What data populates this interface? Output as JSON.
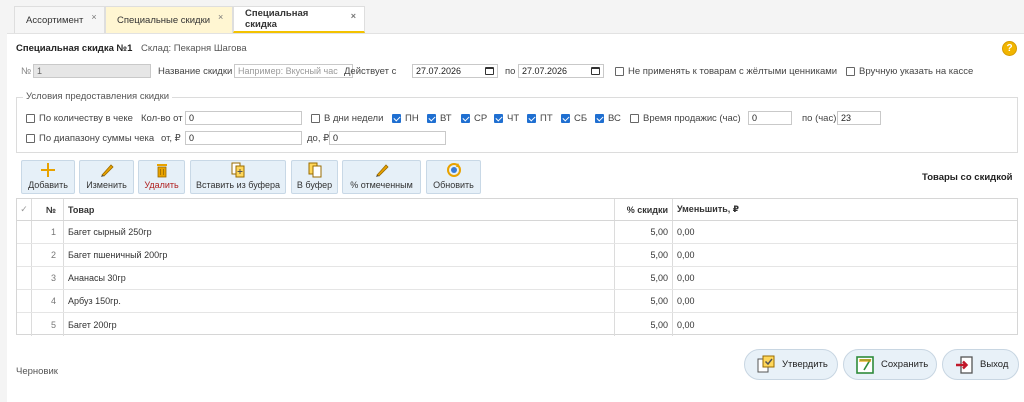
{
  "tabs": [
    {
      "label": "Ассортимент",
      "close": "×"
    },
    {
      "label": "Специальные скидки",
      "close": "×"
    },
    {
      "label": "Специальная скидка",
      "close": "×"
    }
  ],
  "header": {
    "title": "Специальная скидка №1",
    "warehouse": "Склад: Пекарня Шагова",
    "help": "?"
  },
  "form": {
    "number_label": "№",
    "number_value": "1",
    "name_label": "Название скидки",
    "name_placeholder": "Например: Вкусный час",
    "from_label": "Действует с",
    "from_value": "27.07.2026",
    "to_label": "по",
    "to_value": "27.07.2026",
    "no_yellow_label": "Не применять к товарам с жёлтыми ценниками",
    "manual_label": "Вручную указать на кассе"
  },
  "conditions": {
    "title": "Условия предоставления скидки",
    "by_qty_label": "По количеству в чеке",
    "qty_from_label": "Кол-во от",
    "qty_from_value": "0",
    "weekdays_label": "В дни недели",
    "days": [
      "ПН",
      "ВТ",
      "СР",
      "ЧТ",
      "ПТ",
      "СБ",
      "ВС"
    ],
    "time_label": "Время продажи",
    "time_from_label": "с (час)",
    "time_from_value": "0",
    "time_to_label": "по (час)",
    "time_to_value": "23",
    "by_sum_label": "По диапазону суммы чека",
    "sum_from_label": "от, ₽",
    "sum_from_value": "0",
    "sum_to_label": "до, ₽",
    "sum_to_value": "0"
  },
  "toolbar": {
    "add": "Добавить",
    "edit": "Изменить",
    "delete": "Удалить",
    "paste": "Вставить из буфера",
    "copy": "В буфер",
    "percent": "% отмеченным",
    "refresh": "Обновить",
    "section_title": "Товары со скидкой"
  },
  "grid": {
    "headers": {
      "check": "✓",
      "num": "№",
      "name": "Товар",
      "pct": "% скидки",
      "reduce": "Уменьшить, ₽"
    },
    "rows": [
      {
        "num": "1",
        "name": "Багет сырный 250гр",
        "pct": "5,00",
        "reduce": "0,00"
      },
      {
        "num": "2",
        "name": "Багет пшеничный 200гр",
        "pct": "5,00",
        "reduce": "0,00"
      },
      {
        "num": "3",
        "name": "Ананасы 30гр",
        "pct": "5,00",
        "reduce": "0,00"
      },
      {
        "num": "4",
        "name": "Арбуз 150гр.",
        "pct": "5,00",
        "reduce": "0,00"
      },
      {
        "num": "5",
        "name": "Багет 200гр",
        "pct": "5,00",
        "reduce": "0,00"
      }
    ]
  },
  "footer": {
    "status": "Черновик",
    "approve": "Утвердить",
    "save": "Сохранить",
    "exit": "Выход"
  },
  "colors": {
    "accent": "#f3c200",
    "checkbox": "#1f6fd1",
    "button_bg": "#e6f0f8",
    "delete_text": "#b02020"
  }
}
